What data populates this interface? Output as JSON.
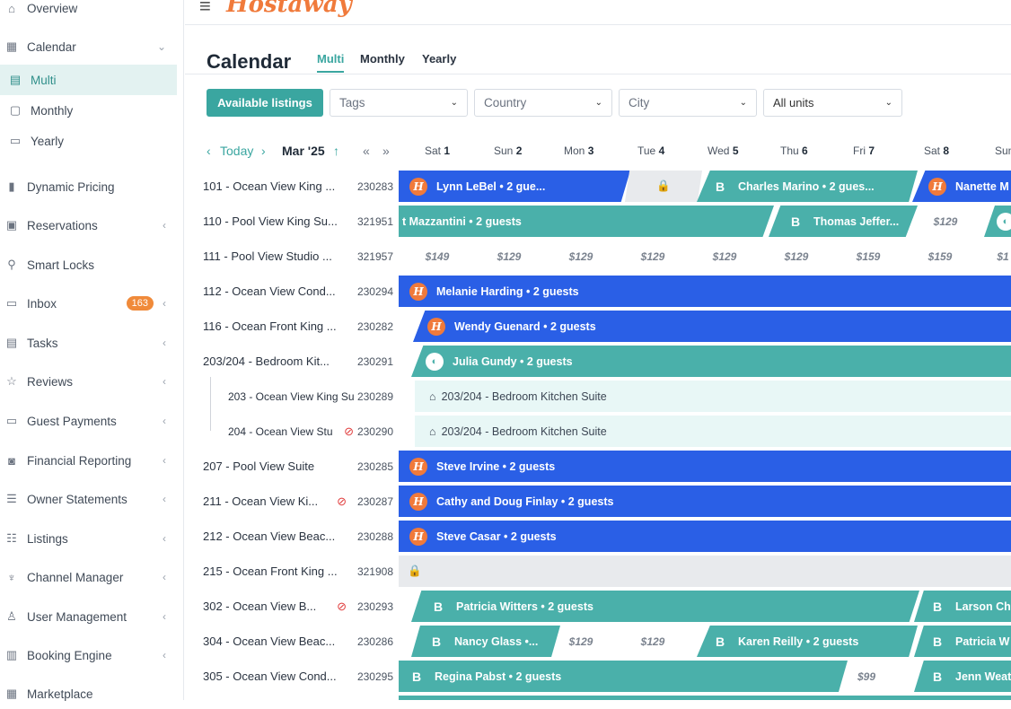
{
  "app": {
    "logo": "Hostaway"
  },
  "sidebar": {
    "items": [
      {
        "label": "Overview",
        "icon": "⌂",
        "chev": ""
      },
      {
        "label": "Calendar",
        "icon": "▦",
        "chev": "⌄"
      },
      {
        "label": "Multi",
        "icon": "▤",
        "chev": ""
      },
      {
        "label": "Monthly",
        "icon": "▢",
        "chev": ""
      },
      {
        "label": "Yearly",
        "icon": "▭",
        "chev": ""
      },
      {
        "label": "Dynamic Pricing",
        "icon": "▮",
        "chev": ""
      },
      {
        "label": "Reservations",
        "icon": "▣",
        "chev": "‹"
      },
      {
        "label": "Smart Locks",
        "icon": "⚲",
        "chev": ""
      },
      {
        "label": "Inbox",
        "icon": "▭",
        "chev": "‹",
        "badge": "163"
      },
      {
        "label": "Tasks",
        "icon": "▤",
        "chev": "‹"
      },
      {
        "label": "Reviews",
        "icon": "☆",
        "chev": "‹"
      },
      {
        "label": "Guest Payments",
        "icon": "▭",
        "chev": "‹"
      },
      {
        "label": "Financial Reporting",
        "icon": "◙",
        "chev": "‹"
      },
      {
        "label": "Owner Statements",
        "icon": "☰",
        "chev": "‹"
      },
      {
        "label": "Listings",
        "icon": "☷",
        "chev": "‹"
      },
      {
        "label": "Channel Manager",
        "icon": "♆",
        "chev": "‹"
      },
      {
        "label": "User Management",
        "icon": "♙",
        "chev": "‹"
      },
      {
        "label": "Booking Engine",
        "icon": "▥",
        "chev": "‹"
      },
      {
        "label": "Marketplace",
        "icon": "▦",
        "chev": ""
      }
    ]
  },
  "page": {
    "title": "Calendar",
    "tabs": [
      "Multi",
      "Monthly",
      "Yearly"
    ]
  },
  "filters": {
    "available": "Available listings",
    "tags": "Tags",
    "country": "Country",
    "city": "City",
    "units": "All units"
  },
  "nav": {
    "prev": "‹",
    "today": "Today",
    "next": "›",
    "month": "Mar '25",
    "sort": "↑",
    "first": "«",
    "last": "»"
  },
  "days": [
    {
      "dow": "Sat",
      "num": "1"
    },
    {
      "dow": "Sun",
      "num": "2"
    },
    {
      "dow": "Mon",
      "num": "3"
    },
    {
      "dow": "Tue",
      "num": "4"
    },
    {
      "dow": "Wed",
      "num": "5"
    },
    {
      "dow": "Thu",
      "num": "6"
    },
    {
      "dow": "Fri",
      "num": "7"
    },
    {
      "dow": "Sat",
      "num": "8"
    },
    {
      "dow": "Sun",
      "num": ""
    }
  ],
  "listings": [
    {
      "name": "101 - Ocean View King ...",
      "id": "230283"
    },
    {
      "name": "110 - Pool View King Su...",
      "id": "321951"
    },
    {
      "name": "111 - Pool View Studio ...",
      "id": "321957"
    },
    {
      "name": "112 - Ocean View Cond...",
      "id": "230294"
    },
    {
      "name": "116 - Ocean Front King ...",
      "id": "230282"
    },
    {
      "name": "203/204 - Bedroom Kit...",
      "id": "230291"
    },
    {
      "name": "203 - Ocean View King Su",
      "id": "230289",
      "sub": true
    },
    {
      "name": "204 - Ocean View Stu",
      "id": "230290",
      "sub": true,
      "blocked": true
    },
    {
      "name": "207 - Pool View Suite",
      "id": "230285"
    },
    {
      "name": "211 - Ocean View Ki...",
      "id": "230287",
      "blocked": true
    },
    {
      "name": "212 - Ocean View Beac...",
      "id": "230288"
    },
    {
      "name": "215 - Ocean Front King ...",
      "id": "321908"
    },
    {
      "name": "302 - Ocean View B...",
      "id": "230293",
      "blocked": true
    },
    {
      "name": "304 - Ocean View Beac...",
      "id": "230286"
    },
    {
      "name": "305 - Ocean View Cond...",
      "id": "230295"
    }
  ],
  "bookings": {
    "r0a": "Lynn LeBel • 2 gue...",
    "r0b": "Charles Marino • 2 gues...",
    "r0c": "Nanette M",
    "r1a": "t Mazzantini • 2 guests",
    "r1b": "Thomas Jeffer...",
    "r1p": "$129",
    "r2p": [
      "$149",
      "$129",
      "$129",
      "$129",
      "$129",
      "$129",
      "$159",
      "$159",
      "$1"
    ],
    "r3": "Melanie Harding • 2 guests",
    "r4": "Wendy Guenard • 2 guests",
    "r5": "Julia Gundy • 2 guests",
    "r6": "203/204 - Bedroom Kitchen Suite",
    "r7": "203/204 - Bedroom Kitchen Suite",
    "r8": "Steve Irvine • 2 guests",
    "r9": "Cathy and Doug Finlay • 2 guests",
    "r10": "Steve Casar • 2 guests",
    "r12a": "Patricia Witters • 2 guests",
    "r12b": "Larson Ch",
    "r13a": "Nancy Glass •...",
    "r13p1": "$129",
    "r13p2": "$129",
    "r13b": "Karen Reilly • 2 guests",
    "r13c": "Patricia W",
    "r14a": "Regina Pabst • 2 guests",
    "r14p": "$99",
    "r14b": "Jenn Weat"
  },
  "colors": {
    "accent": "#3aa6a0",
    "booking_blue": "#2a5fe6",
    "booking_teal": "#4ab0aa",
    "logo": "#f07a3b",
    "badge": "#f08a3a"
  }
}
